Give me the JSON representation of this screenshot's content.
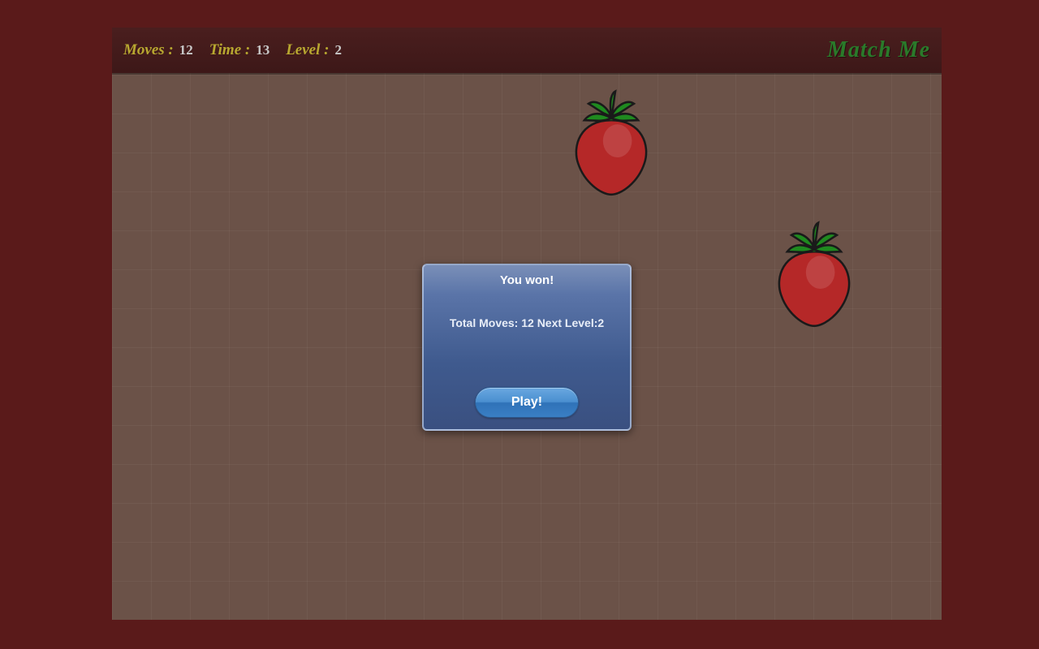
{
  "header": {
    "moves_label": "Moves :",
    "moves_value": "12",
    "time_label": "Time :",
    "time_value": "13",
    "level_label": "Level :",
    "level_value": "2",
    "title": "Match Me"
  },
  "cards": [
    {
      "name": "strawberry-icon"
    },
    {
      "name": "strawberry-icon"
    }
  ],
  "dialog": {
    "title": "You won!",
    "body": "Total Moves: 12 Next Level:2",
    "button_label": "Play!"
  }
}
